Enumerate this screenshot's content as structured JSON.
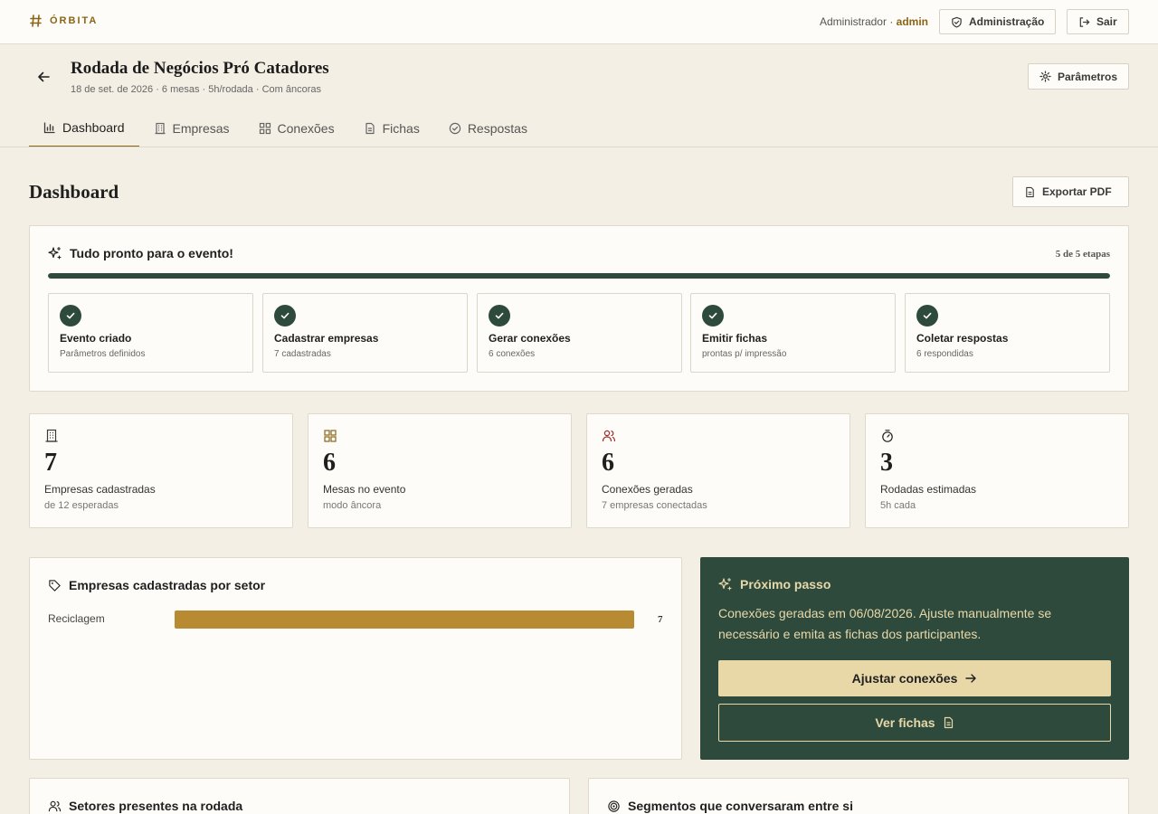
{
  "topbar": {
    "brand": "ÓRBITA",
    "user_role": "Administrador",
    "user_sep": " · ",
    "user_name": "admin",
    "admin_button": "Administração",
    "logout_button": "Sair"
  },
  "event": {
    "title": "Rodada de Negócios Pró Catadores",
    "meta": "18 de set. de 2026 · 6 mesas · 5h/rodada · Com âncoras",
    "params_button": "Parâmetros"
  },
  "tabs": [
    {
      "label": "Dashboard",
      "icon": "bar-chart-icon",
      "active": true
    },
    {
      "label": "Empresas",
      "icon": "building-icon",
      "active": false
    },
    {
      "label": "Conexões",
      "icon": "grid-icon",
      "active": false
    },
    {
      "label": "Fichas",
      "icon": "document-icon",
      "active": false
    },
    {
      "label": "Respostas",
      "icon": "check-circle-icon",
      "active": false
    }
  ],
  "page": {
    "title": "Dashboard",
    "export_button": "Exportar PDF"
  },
  "readiness": {
    "title": "Tudo pronto para o evento!",
    "count_label": "5 de 5 etapas",
    "progress": 1.0,
    "steps": [
      {
        "title": "Evento criado",
        "sub": "Parâmetros definidos"
      },
      {
        "title": "Cadastrar empresas",
        "sub": "7 cadastradas"
      },
      {
        "title": "Gerar conexões",
        "sub": "6 conexões"
      },
      {
        "title": "Emitir fichas",
        "sub": "prontas p/ impressão"
      },
      {
        "title": "Coletar respostas",
        "sub": "6 respondidas"
      }
    ]
  },
  "stats": [
    {
      "value": "7",
      "label": "Empresas cadastradas",
      "sub": "de 12 esperadas",
      "icon": "building-icon",
      "color": "#3a3a3a"
    },
    {
      "value": "6",
      "label": "Mesas no evento",
      "sub": "modo âncora",
      "icon": "grid-icon",
      "color": "#8a6516"
    },
    {
      "value": "6",
      "label": "Conexões geradas",
      "sub": "7 empresas conectadas",
      "icon": "users-icon",
      "color": "#9b2c2c"
    },
    {
      "value": "3",
      "label": "Rodadas estimadas",
      "sub": "5h cada",
      "icon": "timer-icon",
      "color": "#1f1f1f"
    }
  ],
  "sector_chart": {
    "title": "Empresas cadastradas por setor",
    "rows": [
      {
        "label": "Reciclagem",
        "value": 7,
        "value_label": "7",
        "fraction": 1.0
      }
    ]
  },
  "next_step": {
    "title": "Próximo passo",
    "text": "Conexões geradas em 06/08/2026. Ajuste manualmente se necessário e emita as fichas dos participantes.",
    "primary_button": "Ajustar conexões",
    "secondary_button": "Ver fichas"
  },
  "bottom_sections": {
    "left_title": "Setores presentes na rodada",
    "right_title": "Segmentos que conversaram entre si"
  },
  "colors": {
    "accent_green": "#2e4a3d",
    "accent_gold": "#8a6516",
    "bar_gold": "#b88a32",
    "cream": "#e8d8a8",
    "background": "#f4efe4"
  }
}
